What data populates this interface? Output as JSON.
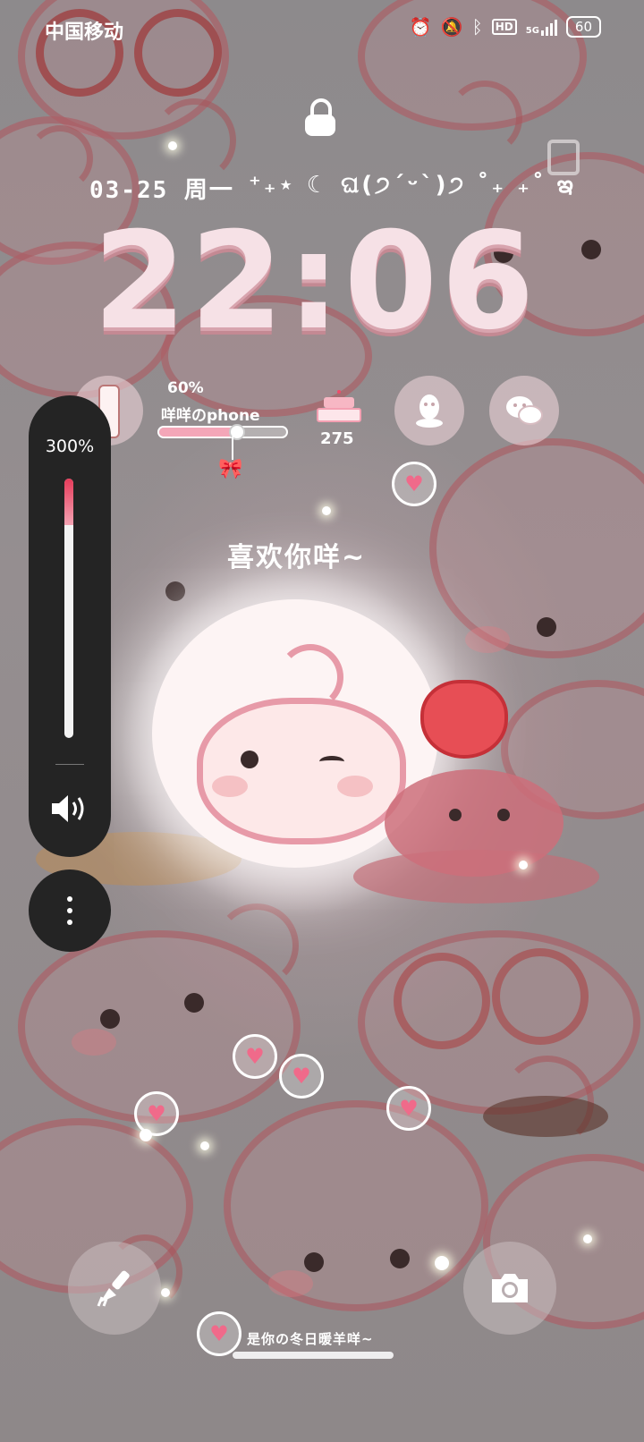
{
  "status_bar": {
    "carrier": "中国移动",
    "network": "5G",
    "hd_label": "HD",
    "battery": "60"
  },
  "lockscreen": {
    "date": "03-25 周一",
    "kaomoji": "⁺₊⋆ ☾ ଘ(੭ˊᵕˋ)੭ ˚₊ ₊˚ ఇ",
    "time": "22:06",
    "greeting": "喜欢你咩~",
    "signature": "是你の冬日暖羊咩~"
  },
  "widgets": {
    "phone_battery_pct": "60%",
    "phone_battery_fraction": 0.6,
    "phone_name": "咩咩のphone",
    "steps": "275"
  },
  "volume": {
    "level_label": "300%",
    "level_fraction": 0.18
  },
  "icons": {
    "alarm": "alarm-icon",
    "mute": "mute-icon",
    "bluetooth": "bluetooth-icon",
    "lock": "lock-icon",
    "qq": "qq-icon",
    "wechat": "wechat-icon",
    "theme": "paintbrush-icon",
    "camera": "camera-icon",
    "speaker": "speaker-icon",
    "more": "more-icon"
  },
  "colors": {
    "accent_pink": "#f4a6b8",
    "volume_red": "#e63b5a",
    "panel_dark": "#242424"
  }
}
